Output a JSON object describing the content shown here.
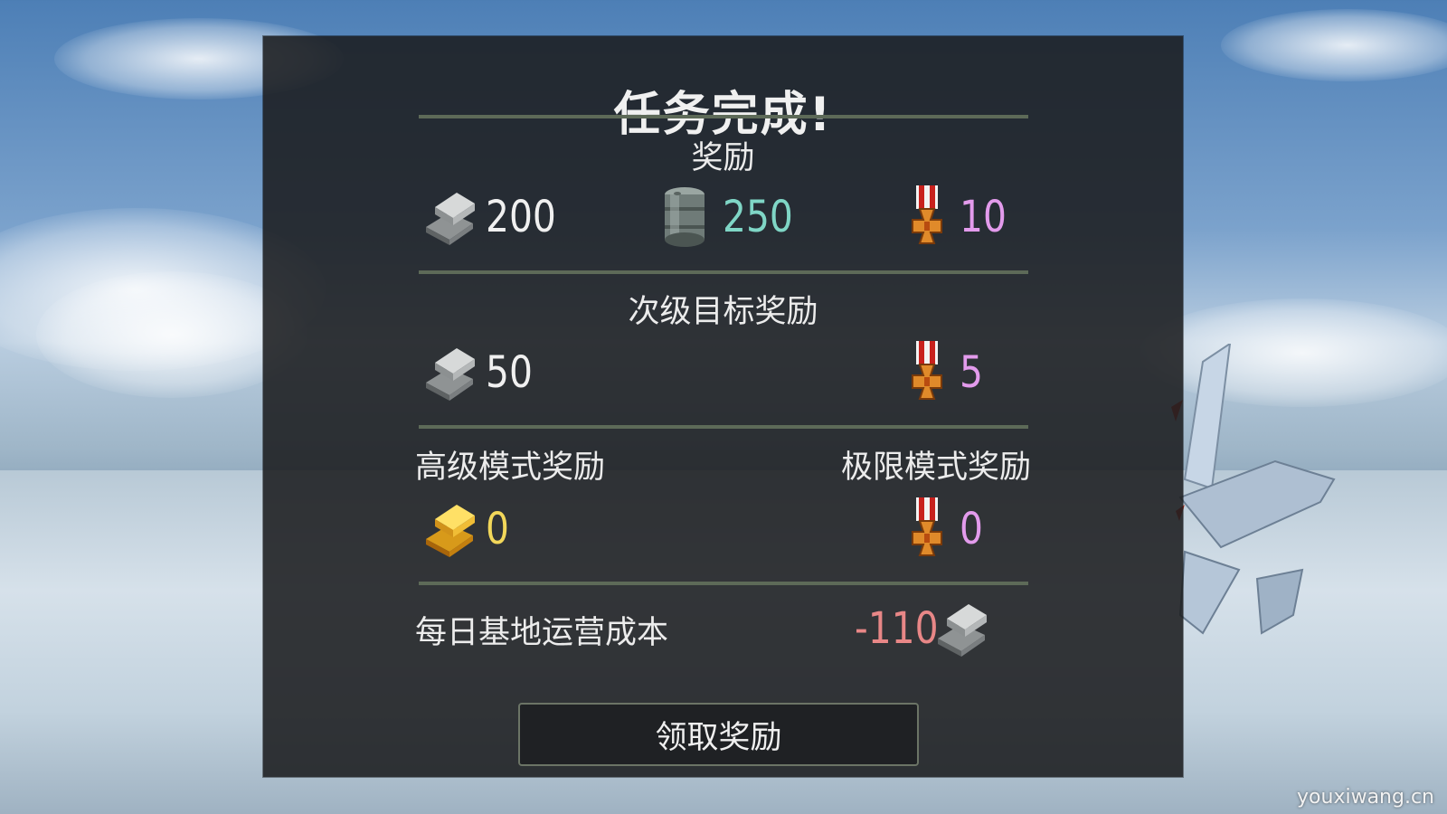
{
  "dialog": {
    "title": "任务完成!",
    "rewards": {
      "heading": "奖励",
      "silver": "200",
      "fuel": "250",
      "medals": "10"
    },
    "secondary": {
      "heading": "次级目标奖励",
      "silver": "50",
      "medals": "5"
    },
    "advanced": {
      "heading": "高级模式奖励",
      "gold": "0"
    },
    "extreme": {
      "heading": "极限模式奖励",
      "medals": "0"
    },
    "daily_cost": {
      "label": "每日基地运营成本",
      "value": "-110"
    },
    "claim_button": "领取奖励"
  },
  "watermark": "youxiwang.cn",
  "colors": {
    "panel": "#1b1d1f",
    "divider": "#5d6a58",
    "silver_value": "#f0f0f0",
    "fuel_value": "#7fd6c6",
    "medal_value": "#e39bec",
    "gold_value": "#f2d75a",
    "cost_value": "#e88787"
  },
  "icons": {
    "silver": "silver-ingot-icon",
    "fuel": "fuel-barrel-icon",
    "medal": "iron-cross-medal-icon",
    "gold": "gold-ingot-icon"
  }
}
